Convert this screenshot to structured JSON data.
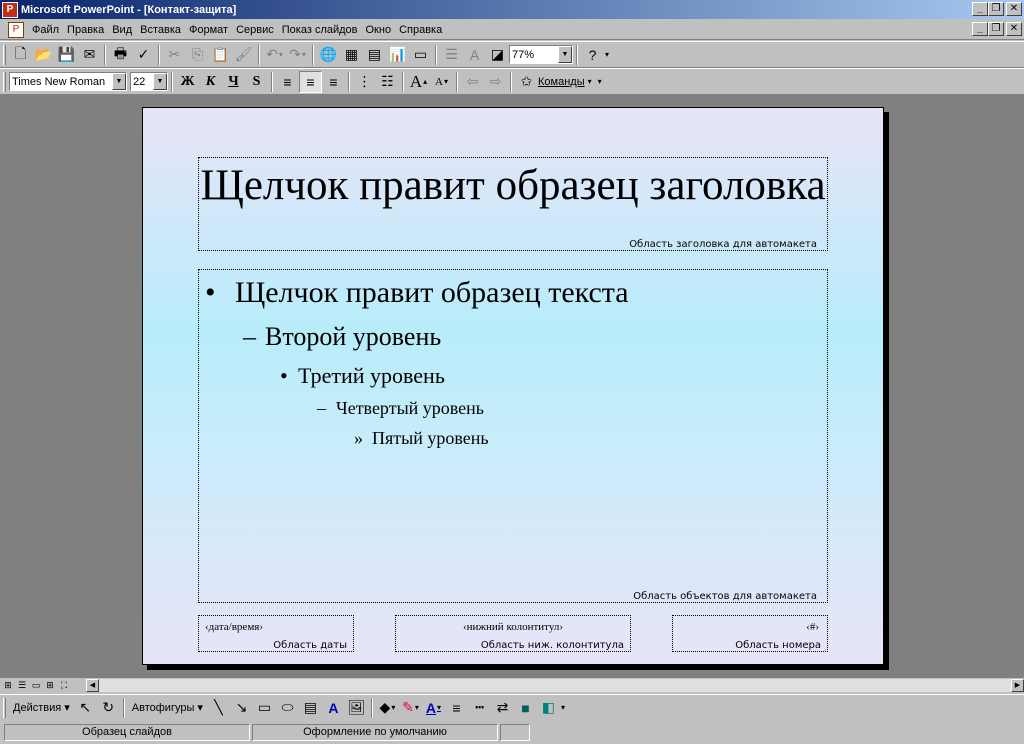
{
  "window": {
    "app_icon": "powerpoint-icon",
    "title": "Microsoft PowerPoint - [Контакт-защита]",
    "buttons": [
      "minimize",
      "restore",
      "close"
    ]
  },
  "menu": {
    "doc_icon": "presentation-document-icon",
    "items": [
      {
        "first": "Ф",
        "rest": "айл"
      },
      {
        "first": "П",
        "rest": "равка"
      },
      {
        "first": "В",
        "rest": "ид"
      },
      {
        "first": "Вст",
        "rest": "авка",
        "u_index": 2
      },
      {
        "first": "Ф",
        "rest": "ормат",
        "u_index": 3
      },
      {
        "first": "С",
        "rest": "ервис",
        "u_index": 0
      },
      {
        "first": "Показ слайдов",
        "rest": ""
      },
      {
        "first": "О",
        "rest": "кно"
      },
      {
        "first": "С",
        "rest": "правка"
      }
    ],
    "labels": [
      "Файл",
      "Правка",
      "Вид",
      "Вставка",
      "Формат",
      "Сервис",
      "Показ слайдов",
      "Окно",
      "Справка"
    ]
  },
  "toolbar_standard": {
    "zoom": "77%"
  },
  "toolbar_format": {
    "font": "Times New Roman",
    "size": "22",
    "bold": "Ж",
    "italic": "К",
    "underline": "Ч",
    "commands": "Команды"
  },
  "slide": {
    "title": "Щелчок правит образец заголовка",
    "title_area": "Область заголовка для автомакета",
    "body_area": "Область объектов для автомакета",
    "levels": [
      {
        "bullet": "•",
        "text": "Щелчок правит образец текста"
      },
      {
        "bullet": "–",
        "text": "Второй уровень"
      },
      {
        "bullet": "•",
        "text": "Третий уровень"
      },
      {
        "bullet": "–",
        "text": "Четвертый уровень"
      },
      {
        "bullet": "»",
        "text": "Пятый уровень"
      }
    ],
    "footer": {
      "date_text": "‹дата/время›",
      "date_area": "Область даты",
      "footer_text": "‹нижний колонтитул›",
      "footer_area": "Область ниж. колонтитула",
      "number_text": "‹#›",
      "number_area": "Область номера"
    }
  },
  "drawing": {
    "actions": "Действия",
    "autoshapes": "Автофигуры"
  },
  "status": {
    "view": "Образец слайдов",
    "design": "Оформление по умолчанию"
  }
}
